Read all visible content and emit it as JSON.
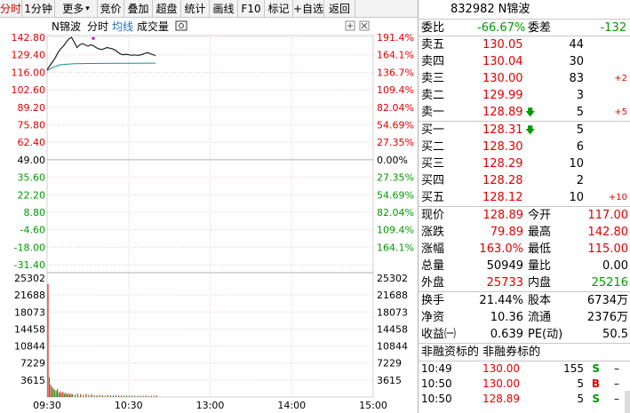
{
  "toolbar": {
    "items": [
      {
        "label": "分时",
        "active": true
      },
      {
        "label": "1分钟",
        "active": false
      },
      {
        "label": "更多",
        "active": false,
        "arrow": "▾"
      },
      {
        "label": "竞价",
        "active": false
      },
      {
        "label": "叠加",
        "active": false
      },
      {
        "label": "超盘",
        "active": false
      },
      {
        "label": "统计",
        "active": false
      },
      {
        "label": "画线",
        "active": false
      },
      {
        "label": "F10",
        "active": false
      },
      {
        "label": "标记",
        "active": false
      },
      {
        "label": "+自选",
        "active": false
      },
      {
        "label": "返回",
        "active": false
      }
    ]
  },
  "chart_header": {
    "stock_name": "N锦波",
    "timeline_label": "分时",
    "avg_label": "均线",
    "volume_label": "成交量",
    "camera_icon": "camera-icon",
    "plus_icon": "plus-box-icon",
    "close_icon": "close-box-icon"
  },
  "chart_data": {
    "type": "line",
    "prev_close": 49.0,
    "price_axis_left": [
      "142.80",
      "129.40",
      "116.00",
      "102.60",
      "89.20",
      "75.80",
      "62.40",
      "49.00",
      "35.60",
      "22.20",
      "8.80",
      "-4.60",
      "-18.00",
      "-31.40"
    ],
    "price_axis_right": [
      "191.4%",
      "164.1%",
      "136.7%",
      "109.4%",
      "82.04%",
      "54.69%",
      "27.35%",
      "0.00%",
      "27.35%",
      "54.69%",
      "82.04%",
      "109.4%",
      "164.1%"
    ],
    "volume_axis_left": [
      "25302",
      "21688",
      "18073",
      "14458",
      "10844",
      "7229",
      "3615"
    ],
    "volume_axis_right": [
      "25302",
      "21688",
      "18073",
      "14458",
      "10844",
      "7229",
      "3615"
    ],
    "time_axis": [
      "09:30",
      "10:30",
      "13:00",
      "14:00",
      "15:00"
    ],
    "price_range": [
      -36.8,
      142.8
    ],
    "volume_max": 25302,
    "price_series": {
      "name": "分时",
      "x": [
        0,
        2,
        4,
        6,
        8,
        10,
        12,
        14,
        16,
        18,
        20,
        22,
        24,
        26,
        28,
        30,
        32,
        34,
        36,
        38,
        40,
        42,
        44,
        46,
        48,
        50,
        52,
        54,
        56,
        58,
        60,
        62,
        64,
        66,
        68,
        70,
        72,
        74,
        76,
        78,
        80
      ],
      "y": [
        118,
        121,
        124,
        127,
        131,
        134,
        136,
        139,
        141.5,
        142.8,
        139,
        135,
        137,
        138,
        137,
        136,
        137,
        136.5,
        135,
        134,
        133.5,
        134,
        135,
        134.5,
        134,
        133,
        131.5,
        130,
        129.5,
        129.8,
        129.5,
        129,
        129.3,
        129,
        129.2,
        129.6,
        130.5,
        131,
        130.2,
        129.4,
        128.9
      ]
    },
    "avg_series": {
      "name": "均线",
      "x": [
        0,
        2,
        4,
        6,
        8,
        10,
        15,
        20,
        30,
        40,
        50,
        60,
        70,
        80
      ],
      "y": [
        117,
        118.5,
        119.5,
        120.5,
        121.3,
        121.8,
        122.2,
        122.5,
        122.7,
        122.8,
        122.9,
        122.9,
        123.0,
        123.0
      ]
    },
    "volume_series": {
      "name": "成交量",
      "x": [
        0,
        1,
        2,
        3,
        4,
        5,
        6,
        7,
        8,
        9,
        10,
        11,
        12,
        13,
        14,
        15,
        16,
        17,
        18,
        20,
        22,
        24,
        26,
        28,
        30,
        32,
        34,
        36,
        38,
        40,
        42,
        44,
        46,
        48,
        50,
        52,
        54,
        56,
        58,
        60,
        62,
        64,
        66,
        68,
        70,
        72,
        74,
        76,
        78,
        80
      ],
      "y": [
        24000,
        4200,
        2600,
        2100,
        1800,
        1500,
        1300,
        1700,
        900,
        1200,
        800,
        1100,
        700,
        900,
        600,
        800,
        500,
        700,
        600,
        500,
        700,
        600,
        500,
        650,
        450,
        600,
        400,
        350,
        500,
        400,
        300,
        450,
        350,
        300,
        400,
        300,
        350,
        250,
        300,
        280,
        320,
        260,
        300,
        240,
        280,
        300,
        260,
        240,
        300,
        280
      ],
      "colors": [
        "red",
        "green",
        "red",
        "green",
        "red",
        "green",
        "green",
        "red",
        "green",
        "red",
        "green",
        "red",
        "green",
        "red",
        "green",
        "red",
        "green",
        "red",
        "green",
        "red",
        "green",
        "red",
        "green",
        "red",
        "green",
        "red",
        "green",
        "red",
        "green",
        "red",
        "green",
        "red",
        "green",
        "red",
        "green",
        "red",
        "green",
        "red",
        "green",
        "red",
        "green",
        "red",
        "green",
        "red",
        "green",
        "red",
        "green",
        "red",
        "green",
        "red"
      ]
    },
    "total_minutes": 240,
    "marker": {
      "x": 34,
      "y": 142.0
    }
  },
  "panel": {
    "code": "832982",
    "name": "N锦波",
    "weibi_label": "委比",
    "weibi_value": "-66.67%",
    "weicha_label": "委差",
    "weicha_value": "-132",
    "sell": [
      {
        "label": "卖五",
        "price": "130.05",
        "vol": "44",
        "chg": ""
      },
      {
        "label": "卖四",
        "price": "130.04",
        "vol": "30",
        "chg": ""
      },
      {
        "label": "卖三",
        "price": "130.00",
        "vol": "83",
        "chg": "+2"
      },
      {
        "label": "卖二",
        "price": "129.99",
        "vol": "3",
        "chg": ""
      },
      {
        "label": "卖一",
        "price": "128.89",
        "vol": "5",
        "chg": "+5",
        "arrow": "down-arrow-icon"
      }
    ],
    "buy": [
      {
        "label": "买一",
        "price": "128.31",
        "vol": "5",
        "chg": "",
        "arrow": "down-arrow-icon"
      },
      {
        "label": "买二",
        "price": "128.30",
        "vol": "6",
        "chg": ""
      },
      {
        "label": "买三",
        "price": "128.29",
        "vol": "10",
        "chg": ""
      },
      {
        "label": "买四",
        "price": "128.28",
        "vol": "2",
        "chg": ""
      },
      {
        "label": "买五",
        "price": "128.12",
        "vol": "10",
        "chg": "+10"
      }
    ],
    "stats": [
      {
        "l1": "现价",
        "v1": "128.89",
        "c1": "red",
        "l2": "今开",
        "v2": "117.00",
        "c2": "red"
      },
      {
        "l1": "涨跌",
        "v1": "79.89",
        "c1": "red",
        "l2": "最高",
        "v2": "142.80",
        "c2": "red"
      },
      {
        "l1": "涨幅",
        "v1": "163.0%",
        "c1": "red",
        "l2": "最低",
        "v2": "115.00",
        "c2": "red"
      },
      {
        "l1": "总量",
        "v1": "50949",
        "c1": "black",
        "l2": "量比",
        "v2": "0.00",
        "c2": "black"
      },
      {
        "l1": "外盘",
        "v1": "25733",
        "c1": "red",
        "l2": "内盘",
        "v2": "25216",
        "c2": "green"
      }
    ],
    "stats2": [
      {
        "l1": "换手",
        "v1": "21.44%",
        "l2": "股本",
        "v2": "6734万"
      },
      {
        "l1": "净资",
        "v1": "10.36",
        "l2": "流通",
        "v2": "2376万"
      },
      {
        "l1": "收益㈠",
        "v1": "0.639",
        "l2": "PE(动)",
        "v2": "50.5"
      }
    ],
    "tick_header": "非融资标的 非融券标的",
    "ticks": [
      {
        "time": "10:49",
        "price": "130.00",
        "vol": "155",
        "bs": "S",
        "bs_color": "green",
        "extra": "–"
      },
      {
        "time": "10:50",
        "price": "130.00",
        "vol": "5",
        "bs": "B",
        "bs_color": "red",
        "extra": "–"
      },
      {
        "time": "10:50",
        "price": "128.89",
        "vol": "5",
        "bs": "S",
        "bs_color": "green",
        "extra": "–"
      }
    ]
  },
  "colors": {
    "up": "#e00000",
    "down": "#009b00",
    "price_line": "#202020",
    "avg_line": "#1a8a9a",
    "grid": "#d0d0d0",
    "grid_dash": "#e3c8c8",
    "marker": "#d000d0"
  }
}
